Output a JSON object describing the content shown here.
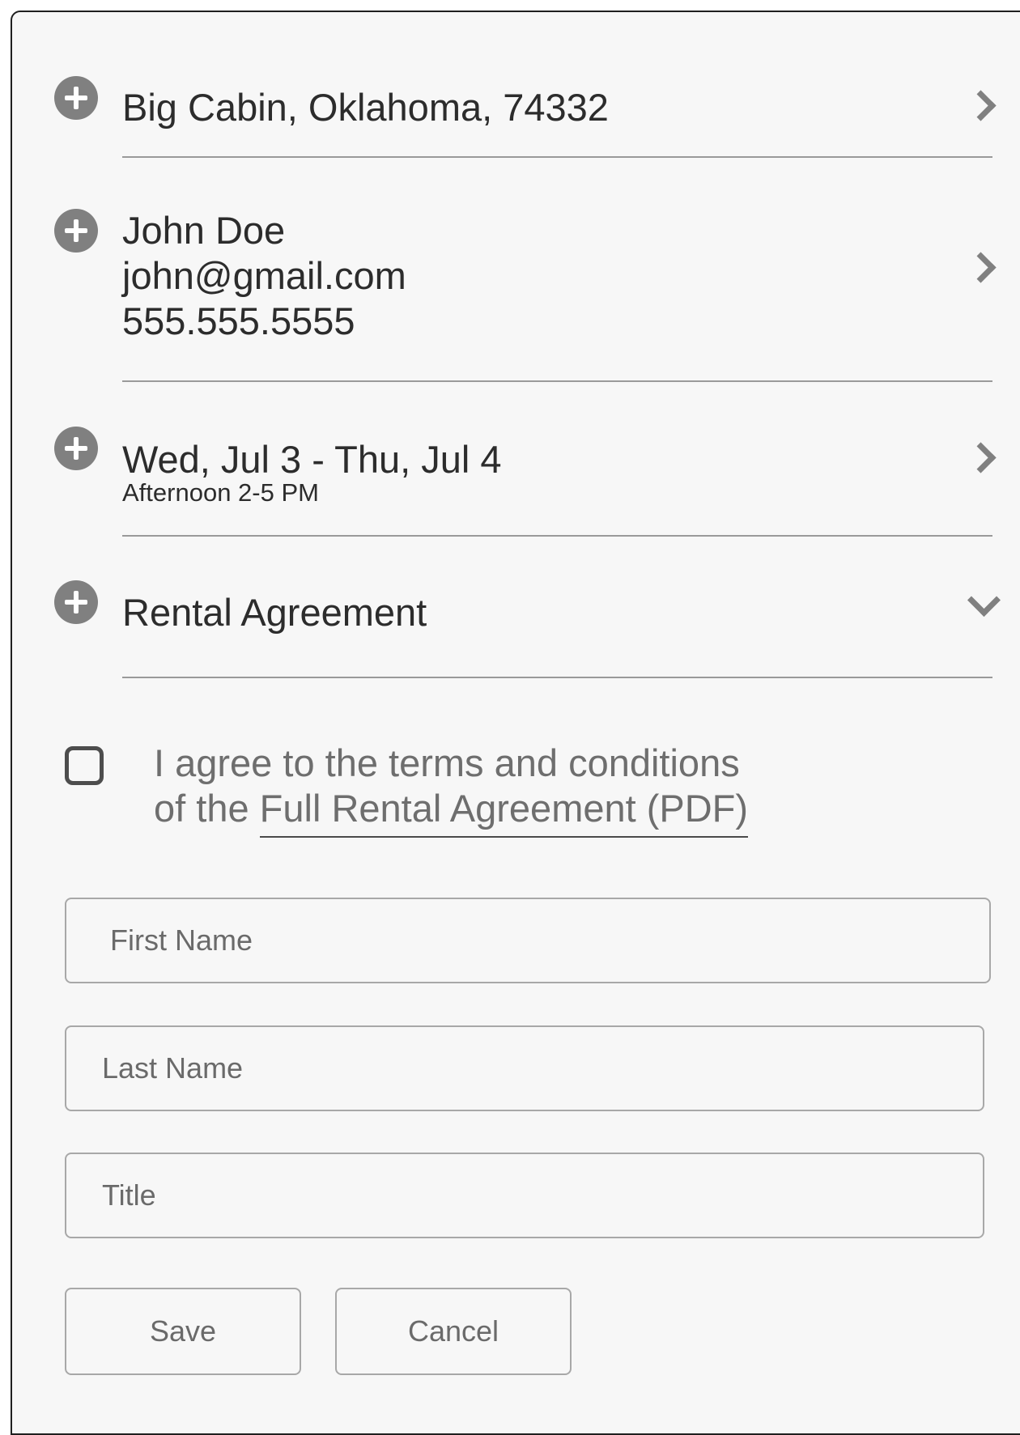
{
  "location": {
    "text": "Big Cabin, Oklahoma, 74332"
  },
  "contact": {
    "name": "John Doe",
    "email": "john@gmail.com",
    "phone": "555.555.5555"
  },
  "dates": {
    "range": "Wed, Jul 3 - Thu, Jul 4",
    "time_slot": "Afternoon 2-5 PM"
  },
  "agreement": {
    "title": "Rental Agreement",
    "terms_line1": "I agree to the terms and conditions",
    "terms_prefix": "of the ",
    "terms_link": "Full Rental Agreement (PDF)"
  },
  "form": {
    "first_name_placeholder": "First Name",
    "last_name_placeholder": "Last Name",
    "title_placeholder": "Title",
    "save_label": "Save",
    "cancel_label": "Cancel"
  },
  "icons": {
    "section_add": "plus-circle-icon",
    "expand_row": "chevron-right-icon",
    "expanded_section": "chevron-down-icon"
  },
  "colors": {
    "background": "#f7f7f7",
    "icon_gray": "#808080",
    "text_dark": "#2c2c2c",
    "text_muted": "#6e6e6e",
    "border": "#a8a8a8"
  }
}
